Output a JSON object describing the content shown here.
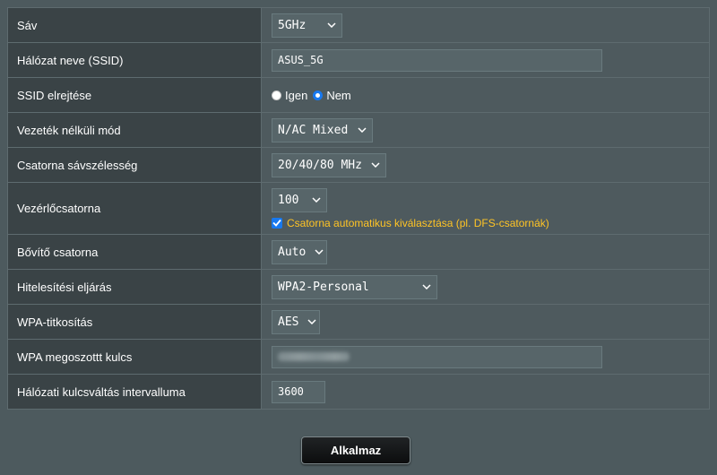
{
  "rows": [
    {
      "label": "Sáv",
      "value": "5GHz"
    },
    {
      "label": "Hálózat neve (SSID)",
      "value": "ASUS_5G"
    },
    {
      "label": "SSID elrejtése",
      "options": [
        "Igen",
        "Nem"
      ],
      "selected": "Nem"
    },
    {
      "label": "Vezeték nélküli mód",
      "value": "N/AC Mixed"
    },
    {
      "label": "Csatorna sávszélesség",
      "value": "20/40/80 MHz"
    },
    {
      "label": "Vezérlőcsatorna",
      "value": "100",
      "checkbox_label": "Csatorna automatikus kiválasztása (pl. DFS-csatornák)",
      "checkbox_checked": true
    },
    {
      "label": "Bővítő csatorna",
      "value": "Auto"
    },
    {
      "label": "Hitelesítési eljárás",
      "value": "WPA2-Personal"
    },
    {
      "label": "WPA-titkosítás",
      "value": "AES"
    },
    {
      "label": "WPA megoszottt kulcs",
      "value_obscured": true
    },
    {
      "label": "Hálózati kulcsváltás intervalluma",
      "value": "3600"
    }
  ],
  "apply_button": "Alkalmaz",
  "colors": {
    "accent_blue": "#1778ef",
    "checkbox_label": "#ffc425",
    "label_bg": "#3a4346",
    "value_bg": "#4e5a5e"
  },
  "icons": {
    "dropdown": "chevron-down-icon",
    "check": "checkmark-icon"
  }
}
